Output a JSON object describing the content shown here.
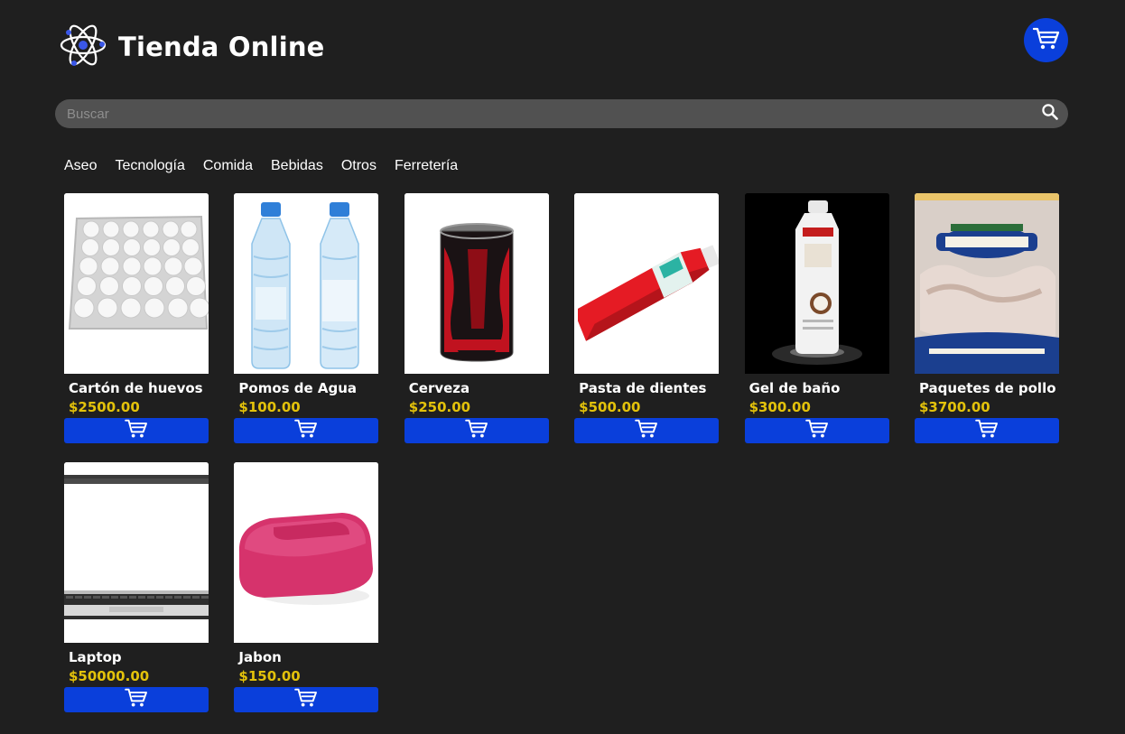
{
  "header": {
    "title": "Tienda Online",
    "logo_icon": "atom-icon",
    "cart_icon": "cart-icon",
    "accent": "#0a3fdb"
  },
  "search": {
    "placeholder": "Buscar",
    "value": "",
    "icon": "search-icon"
  },
  "categories": [
    "Aseo",
    "Tecnología",
    "Comida",
    "Bebidas",
    "Otros",
    "Ferretería"
  ],
  "price_color": "#e3c20b",
  "products": [
    {
      "name": "Cartón de huevos",
      "price": "$2500.00",
      "image": "egg-carton"
    },
    {
      "name": "Pomos de Agua",
      "price": "$100.00",
      "image": "water-bottles"
    },
    {
      "name": "Cerveza",
      "price": "$250.00",
      "image": "beer-can"
    },
    {
      "name": "Pasta de dientes",
      "price": "$500.00",
      "image": "toothpaste"
    },
    {
      "name": "Gel de baño",
      "price": "$300.00",
      "image": "shower-gel"
    },
    {
      "name": "Paquetes de pollo",
      "price": "$3700.00",
      "image": "chicken-pack"
    },
    {
      "name": "Laptop",
      "price": "$50000.00",
      "image": "laptop"
    },
    {
      "name": "Jabon",
      "price": "$150.00",
      "image": "soap-bar"
    }
  ],
  "add_button_icon": "cart-icon"
}
